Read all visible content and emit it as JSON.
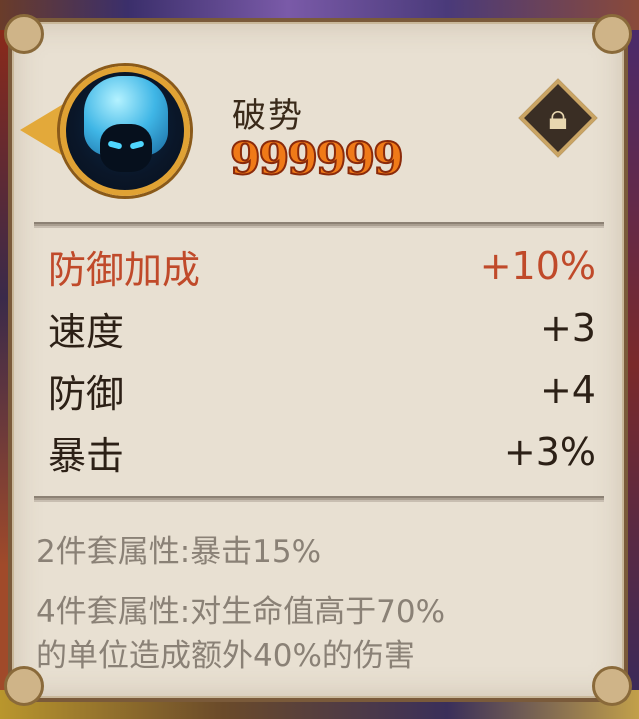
{
  "item": {
    "name": "破势",
    "power": "999999"
  },
  "stats": [
    {
      "label": "防御加成",
      "value": "+10%",
      "highlight": true
    },
    {
      "label": "速度",
      "value": "+3",
      "highlight": false
    },
    {
      "label": "防御",
      "value": "+4",
      "highlight": false
    },
    {
      "label": "暴击",
      "value": "+3%",
      "highlight": false
    }
  ],
  "set_bonuses": {
    "two_piece": "2件套属性:暴击15%",
    "four_piece_line1": "4件套属性:对生命值高于70%",
    "four_piece_line2": "的单位造成额外40%的伤害"
  },
  "icons": {
    "lock": "lock-icon",
    "avatar": "character-portrait"
  },
  "colors": {
    "highlight_stat": "#c04a2a",
    "power_number": "#f07a18",
    "panel_bg": "#e8e0d2",
    "bonus_text": "#8a8176"
  }
}
